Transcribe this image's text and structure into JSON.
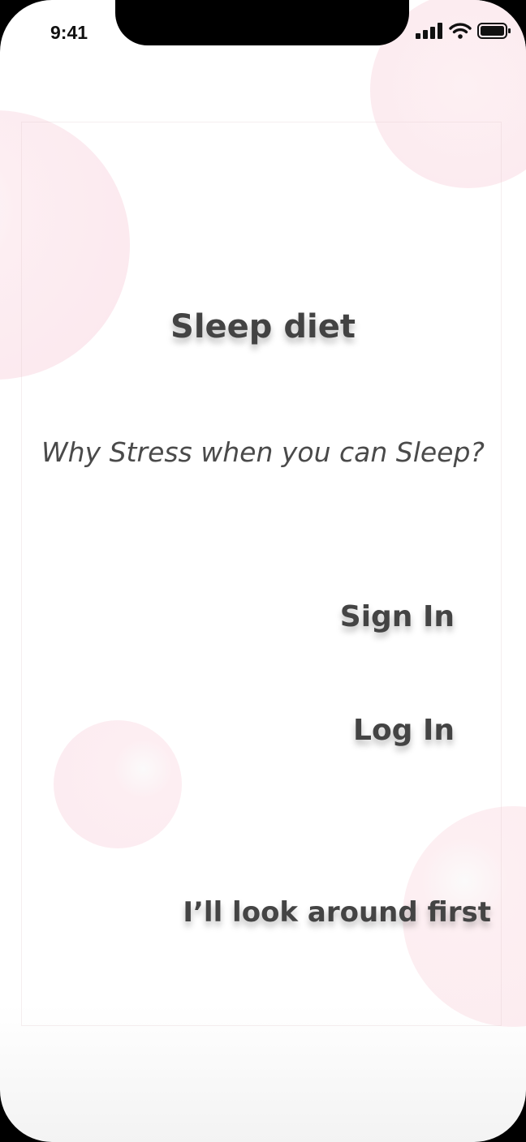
{
  "status_bar": {
    "time": "9:41",
    "icons": [
      "cellular-signal-icon",
      "wifi-icon",
      "battery-icon"
    ],
    "text_color": "#111111"
  },
  "app": {
    "title": "Sleep diet",
    "tagline": "Why Stress when you can Sleep?"
  },
  "actions": {
    "sign_in": "Sign In",
    "log_in": "Log In",
    "look_around": "I’ll look around first"
  },
  "colors": {
    "text": "#444444",
    "bubble": "#fcebf0",
    "background": "#ffffff",
    "device_frame": "#000000"
  }
}
